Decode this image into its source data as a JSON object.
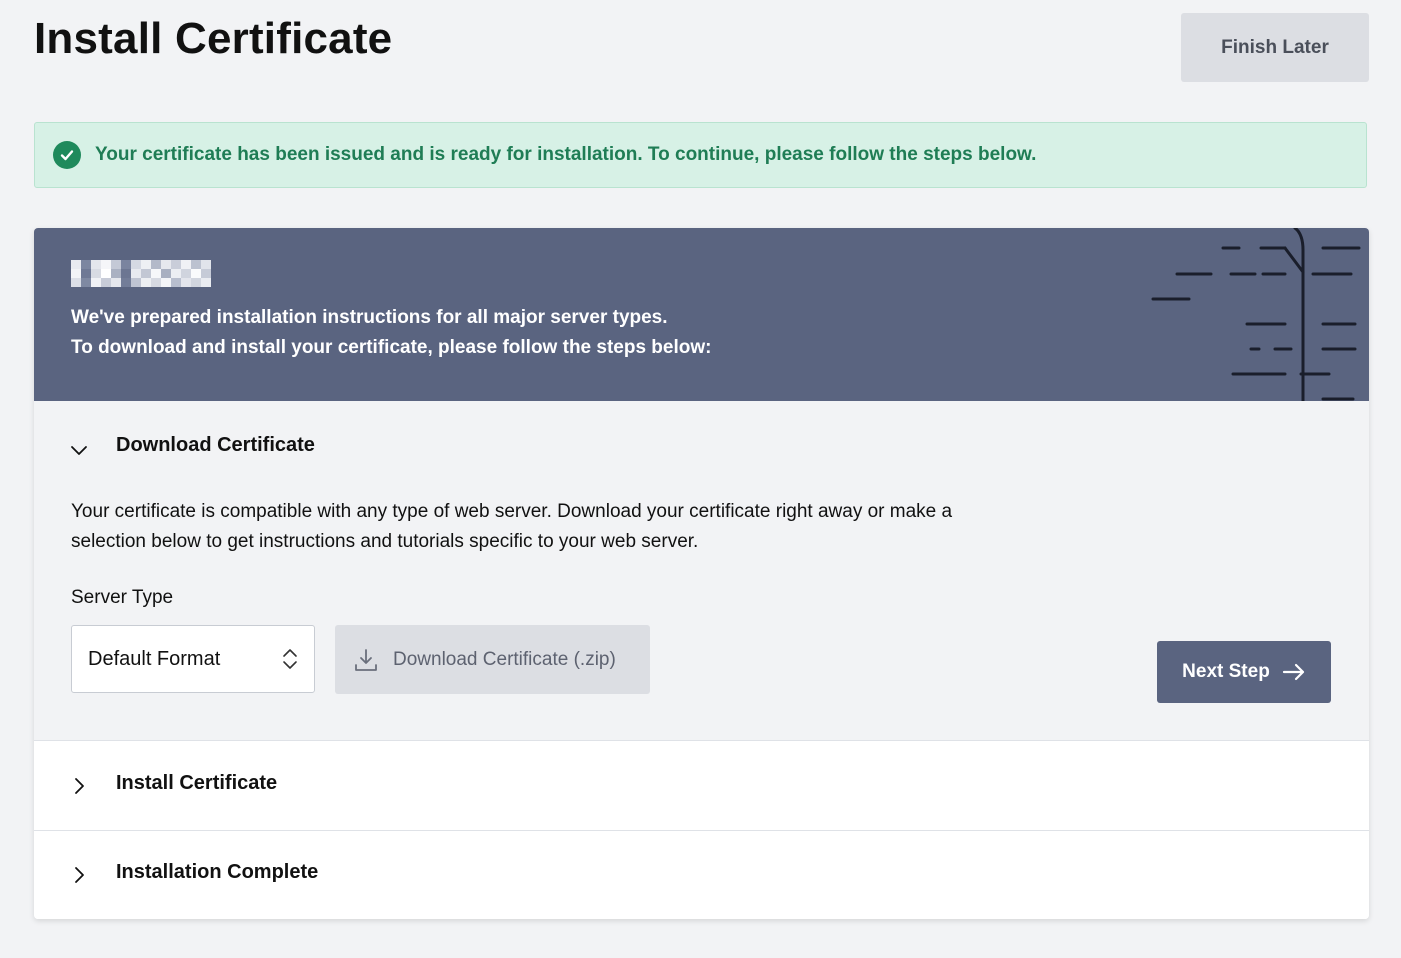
{
  "page": {
    "title": "Install Certificate",
    "finish_later_label": "Finish Later"
  },
  "alert": {
    "message": "Your certificate has been issued and is ready for installation. To continue, please follow the steps below.",
    "icon": "check-circle-icon",
    "color": "#1f8a5c"
  },
  "card": {
    "header": {
      "line1": "We've prepared installation instructions for all major server types.",
      "line2": "To download and install your certificate, please follow the steps below:",
      "background": "#5a6480"
    },
    "steps": [
      {
        "title": "Download Certificate",
        "expanded": true,
        "description": "Your certificate is compatible with any type of web server. Download your certificate right away or make a selection below to get instructions and tutorials specific to your web server.",
        "server_type_label": "Server Type",
        "server_type_value": "Default Format",
        "download_label": "Download Certificate (.zip)",
        "next_label": "Next Step"
      },
      {
        "title": "Install Certificate",
        "expanded": false
      },
      {
        "title": "Installation Complete",
        "expanded": false
      }
    ]
  }
}
